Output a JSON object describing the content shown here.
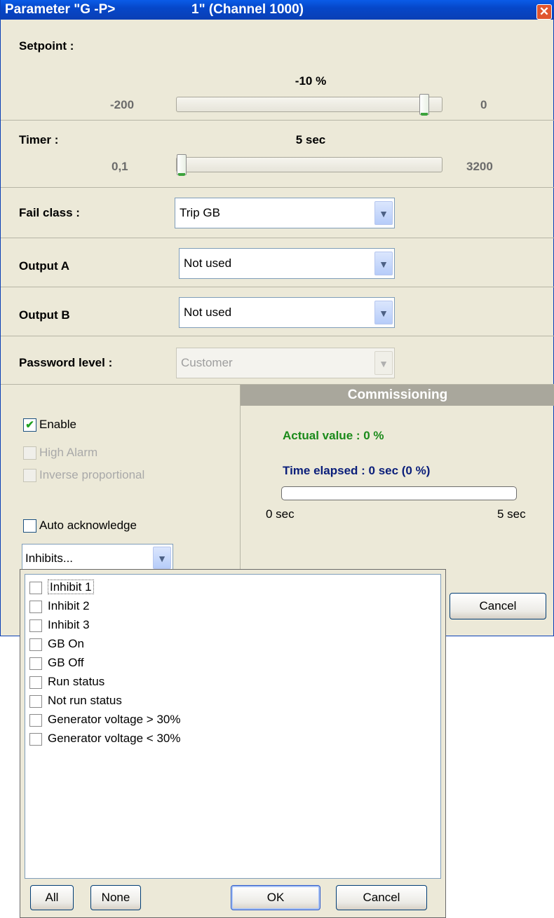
{
  "window": {
    "title_part1": "Parameter \"G -P>",
    "title_part2": "1\" (Channel 1000)"
  },
  "setpoint": {
    "label": "Setpoint :",
    "value_text": "-10 %",
    "min": "-200",
    "max": "0",
    "fraction": 0.95
  },
  "timer": {
    "label": "Timer :",
    "value_text": "5 sec",
    "min": "0,1",
    "max": "3200",
    "fraction": 0.0
  },
  "fail_class": {
    "label": "Fail class :",
    "value": "Trip GB"
  },
  "output_a": {
    "label": "Output A",
    "value": "Not used"
  },
  "output_b": {
    "label": "Output B",
    "value": "Not used"
  },
  "password_level": {
    "label": "Password level :",
    "value": "Customer"
  },
  "options": {
    "enable": {
      "label": "Enable",
      "checked": true
    },
    "high_alarm": {
      "label": "High Alarm",
      "checked": false
    },
    "inverse": {
      "label": "Inverse proportional",
      "checked": false
    },
    "auto_ack": {
      "label": "Auto acknowledge",
      "checked": false
    },
    "inhibits_combo": "Inhibits..."
  },
  "commissioning": {
    "header": "Commissioning",
    "actual_value": "Actual value : 0 %",
    "time_elapsed": "Time elapsed : 0 sec (0 %)",
    "progress": 0,
    "bar_min": "0 sec",
    "bar_max": "5 sec"
  },
  "cancel_button": "Cancel",
  "inhibit_popup": {
    "items": [
      "Inhibit 1",
      "Inhibit 2",
      "Inhibit 3",
      "GB On",
      "GB Off",
      "Run status",
      "Not run status",
      "Generator voltage > 30%",
      "Generator voltage < 30%"
    ],
    "all_button": "All",
    "none_button": "None",
    "ok_button": "OK",
    "cancel_button": "Cancel"
  },
  "colors": {
    "title_bar": "#0a4fd8",
    "actual_value": "#1a8a1a",
    "time_elapsed": "#0a1e7a",
    "slider_thumb_accent": "#3ca33c"
  }
}
